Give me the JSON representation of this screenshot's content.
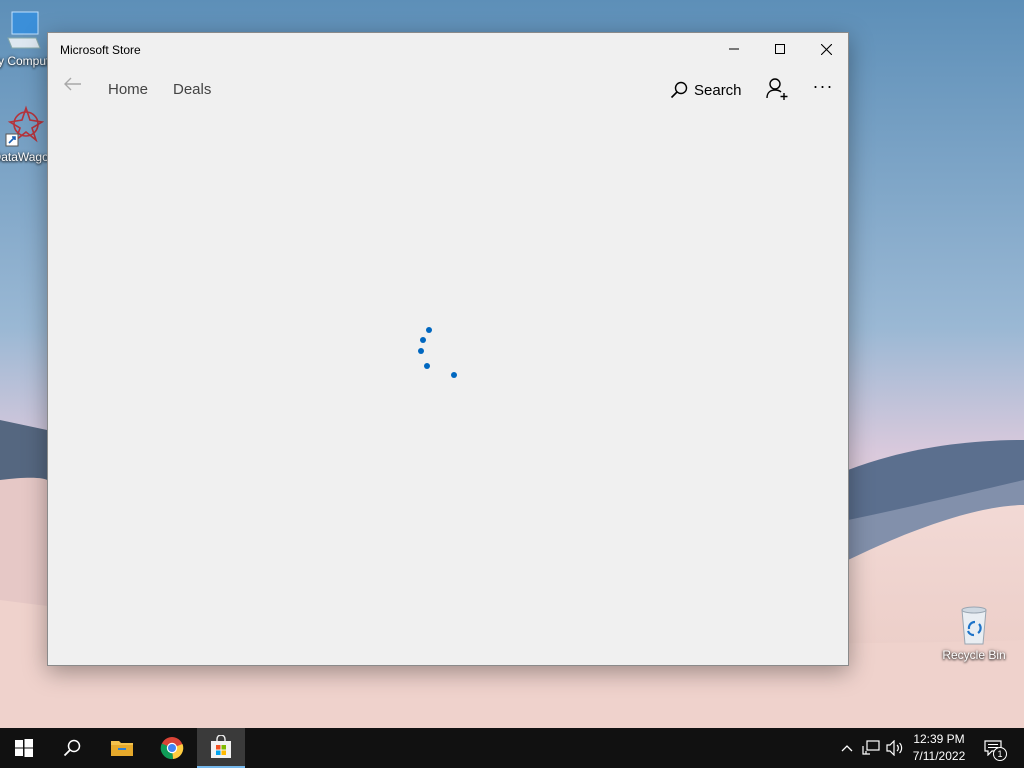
{
  "desktop": {
    "icons": [
      {
        "label": "My Computer",
        "icon": "computer-icon"
      },
      {
        "label": "DataWagon",
        "icon": "datawagon-shortcut-icon"
      },
      {
        "label": "Recycle Bin",
        "icon": "recycle-bin-icon"
      }
    ]
  },
  "window": {
    "title": "Microsoft Store",
    "controls": {
      "minimize": "minimize-icon",
      "maximize": "maximize-icon",
      "close": "close-icon"
    },
    "nav": {
      "back": "back-arrow-icon",
      "home": "Home",
      "deals": "Deals",
      "search": "Search",
      "account": "account-add-icon",
      "more": "···"
    },
    "content": {
      "state": "loading",
      "spinner_color": "#0067c0"
    }
  },
  "taskbar": {
    "apps": [
      "start-icon",
      "search-icon",
      "file-explorer-icon",
      "chrome-icon",
      "store-icon"
    ],
    "active_app": "store-icon",
    "tray": [
      "chevron-up-icon",
      "network-icon",
      "volume-icon"
    ],
    "time": "12:39 PM",
    "date": "7/11/2022",
    "notifications": "1"
  }
}
